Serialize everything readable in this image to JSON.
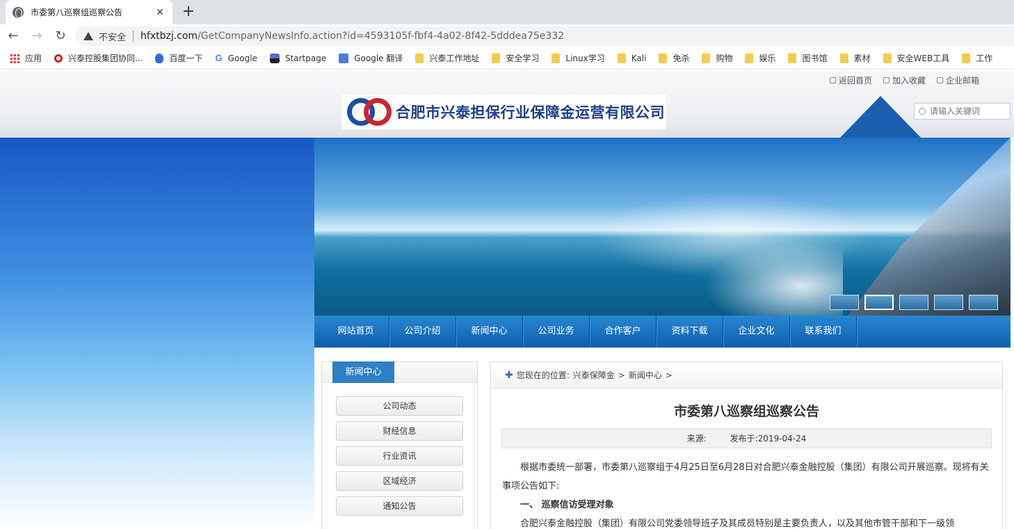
{
  "browser": {
    "tab_title": "市委第八巡察组巡察公告",
    "insecure_label": "不安全",
    "url_host": "hfxtbzj.com",
    "url_rest": "/GetCompanyNewsInfo.action?id=4593105f-fbf4-4a02-8f42-5dddea75e332",
    "bookmarks": [
      "应用",
      "兴泰控股集团协同...",
      "百度一下",
      "Google",
      "Startpage",
      "Google 翻译",
      "兴泰工作地址",
      "安全学习",
      "Linux学习",
      "Kali",
      "免杀",
      "购物",
      "娱乐",
      "图书馆",
      "素材",
      "安全WEB工具",
      "工作"
    ]
  },
  "site": {
    "top_links": [
      "返回首页",
      "加入收藏",
      "企业邮箱"
    ],
    "logo_text": "合肥市兴泰担保行业保障金运营有限公司",
    "search_placeholder": "请输入关键词",
    "nav": [
      "网站首页",
      "公司介绍",
      "新闻中心",
      "公司业务",
      "合作客户",
      "资料下载",
      "企业文化",
      "联系我们"
    ]
  },
  "sidebar": {
    "title": "新闻中心",
    "items": [
      "公司动态",
      "财经信息",
      "行业资讯",
      "区域经济",
      "通知公告"
    ]
  },
  "article": {
    "breadcrumb_prefix": "您现在的位置:",
    "breadcrumb": [
      "兴泰保障金",
      "新闻中心"
    ],
    "breadcrumb_sep": ">",
    "title": "市委第八巡察组巡察公告",
    "source_label": "来源:",
    "published": "发布于:2019-04-24",
    "p1": "根据市委统一部署，市委第八巡察组于4月25日至6月28日对合肥兴泰金融控股（集团）有限公司开展巡察。现将有关事项公告如下:",
    "h1": "一、 巡察信访受理对象",
    "p2": "合肥兴泰金融控股（集团）有限公司党委领导班子及其成员特别是主要负责人，以及其他市管干部和下一级领"
  }
}
